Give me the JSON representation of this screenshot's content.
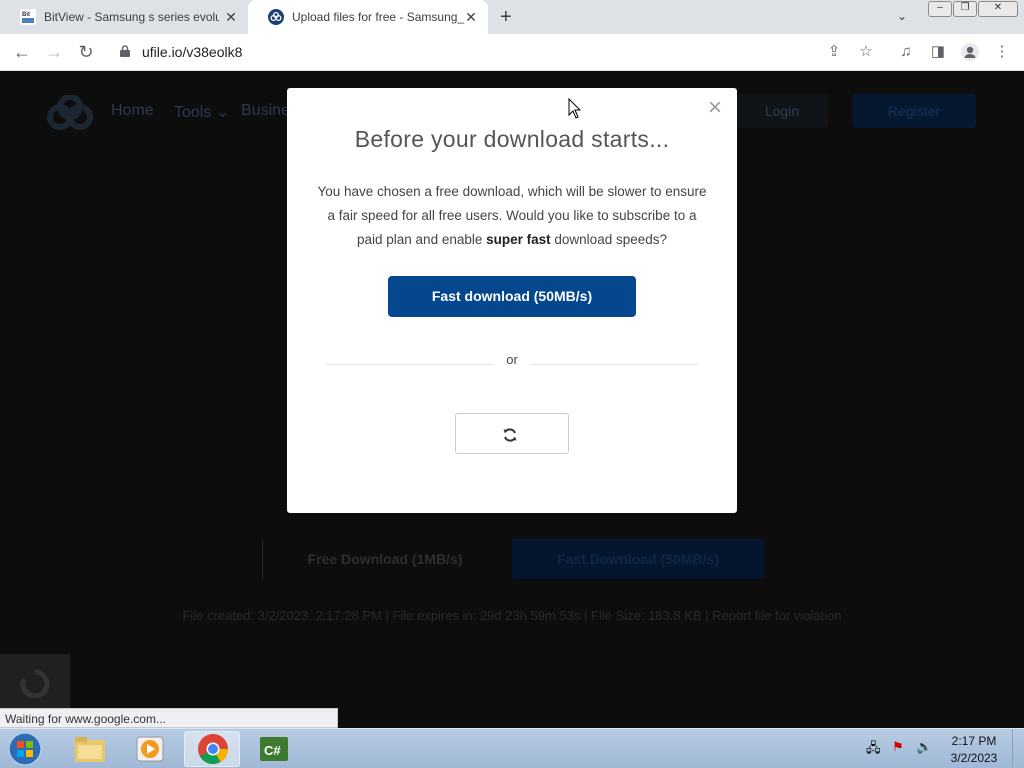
{
  "browser": {
    "tabs": [
      {
        "title": "BitView - Samsung s series evolu",
        "favicon": "bitview-icon",
        "active": false
      },
      {
        "title": "Upload files for free - Samsung_",
        "favicon": "ufile-icon",
        "active": true
      }
    ],
    "new_tab": "+",
    "url": "ufile.io/v38eolk8",
    "status_text": "Waiting for www.google.com..."
  },
  "site": {
    "nav": [
      "Home",
      "Tools",
      "Busine"
    ],
    "tools_caret": "⌄",
    "login": "Login",
    "register": "Register",
    "free_download": "Free Download (1MB/s)",
    "fast_download": "Fast Download (50MB/s)",
    "file_info": "File created: 3/2/2023, 2:17:28 PM   |   File expires in: 29d 23h 59m 53s   |   File Size: 183.8 KB   |   Report file for violation"
  },
  "modal": {
    "title": "Before your download starts...",
    "body_before": "You have chosen a free download, which will be slower to ensure a fair speed for all free users. Would you like to subscribe to a paid plan and enable ",
    "body_bold": "super fast",
    "body_after": " download speeds?",
    "fast_button": "Fast download (50MB/s)",
    "or": "or",
    "close": "×"
  },
  "taskbar": {
    "time": "2:17 PM",
    "date": "3/2/2023"
  },
  "colors": {
    "accent": "#05478e",
    "overlay": "#0d0d0d"
  }
}
